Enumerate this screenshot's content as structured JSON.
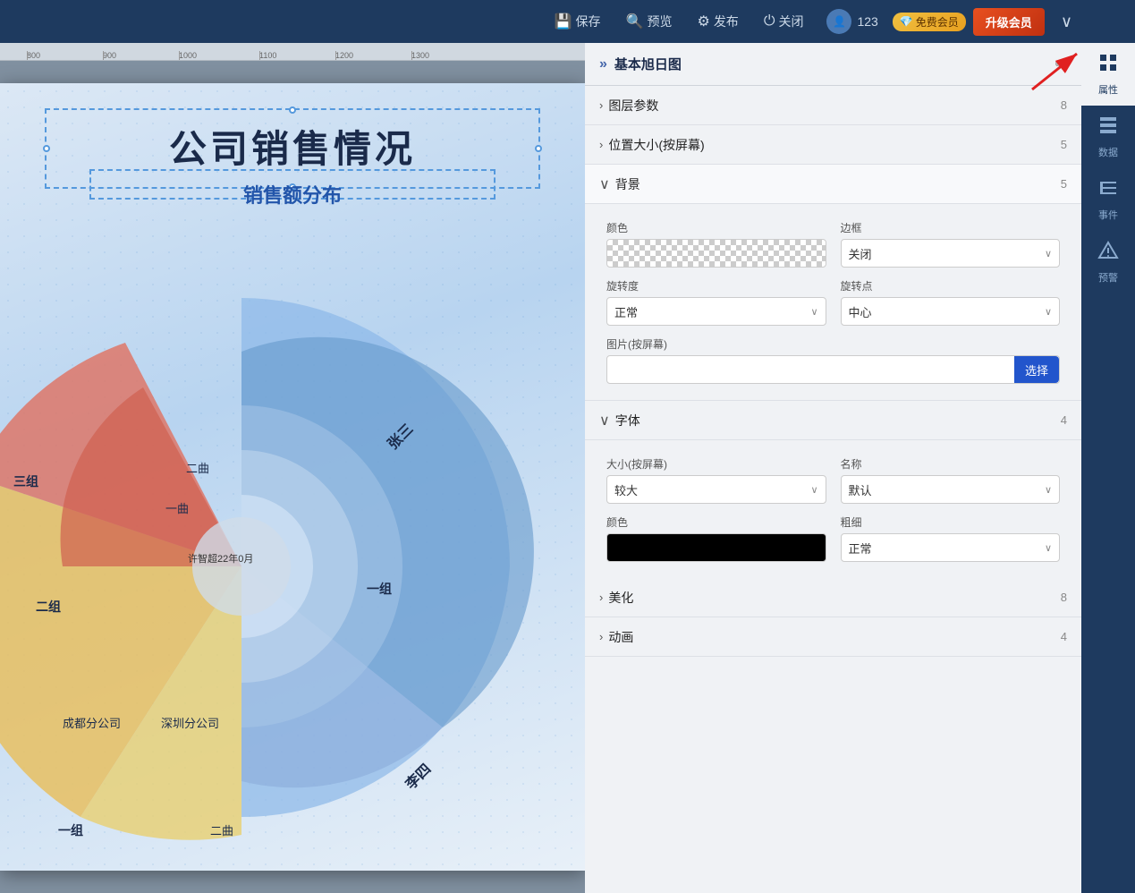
{
  "topbar": {
    "save_label": "保存",
    "preview_label": "预览",
    "publish_label": "发布",
    "close_label": "关闭",
    "user_name": "123",
    "free_badge": "免费会员",
    "upgrade_label": "升级会员"
  },
  "ruler": {
    "marks": [
      "800",
      "900",
      "1000",
      "1100",
      "1200",
      "1300"
    ]
  },
  "slide": {
    "title": "公司销售情况",
    "subtitle": "销售额分布"
  },
  "panel": {
    "header": "基本旭日图",
    "sections": [
      {
        "label": "图层参数",
        "count": "8",
        "expanded": false,
        "chevron": ">"
      },
      {
        "label": "位置大小(按屏幕)",
        "count": "5",
        "expanded": false,
        "chevron": ">"
      },
      {
        "label": "背景",
        "count": "5",
        "expanded": true,
        "chevron": "∨"
      }
    ],
    "background": {
      "color_label": "颜色",
      "border_label": "边框",
      "border_value": "关闭",
      "rotation_label": "旋转度",
      "rotation_value": "正常",
      "pivot_label": "旋转点",
      "pivot_value": "中心",
      "image_label": "图片(按屏幕)",
      "image_select": "选择"
    },
    "font": {
      "label": "字体",
      "count": "4",
      "size_label": "大小(按屏幕)",
      "size_value": "较大",
      "name_label": "名称",
      "name_value": "默认",
      "color_label": "颜色",
      "weight_label": "粗细",
      "weight_value": "正常"
    },
    "beautify": {
      "label": "美化",
      "count": "8",
      "chevron": ">"
    },
    "animation": {
      "label": "动画",
      "count": "4",
      "chevron": ">"
    }
  },
  "sidebar": {
    "items": [
      {
        "label": "属性",
        "icon": "≡",
        "active": true
      },
      {
        "label": "数据",
        "icon": "⊞",
        "active": false
      },
      {
        "label": "事件",
        "icon": "≣",
        "active": false
      },
      {
        "label": "预警",
        "icon": "⚡",
        "active": false
      }
    ]
  },
  "chart": {
    "labels": {
      "zhangsan": "张三",
      "lisi": "李四",
      "group1_outer": "一组",
      "group2_outer": "二组",
      "group3_outer": "三组",
      "group1a": "一曲",
      "group1b": "二曲",
      "group2a": "一组",
      "group3a": "三组",
      "chengdu": "成都分公司",
      "shenzhen": "深圳分公司",
      "center_text": "许智超22年0月"
    }
  }
}
